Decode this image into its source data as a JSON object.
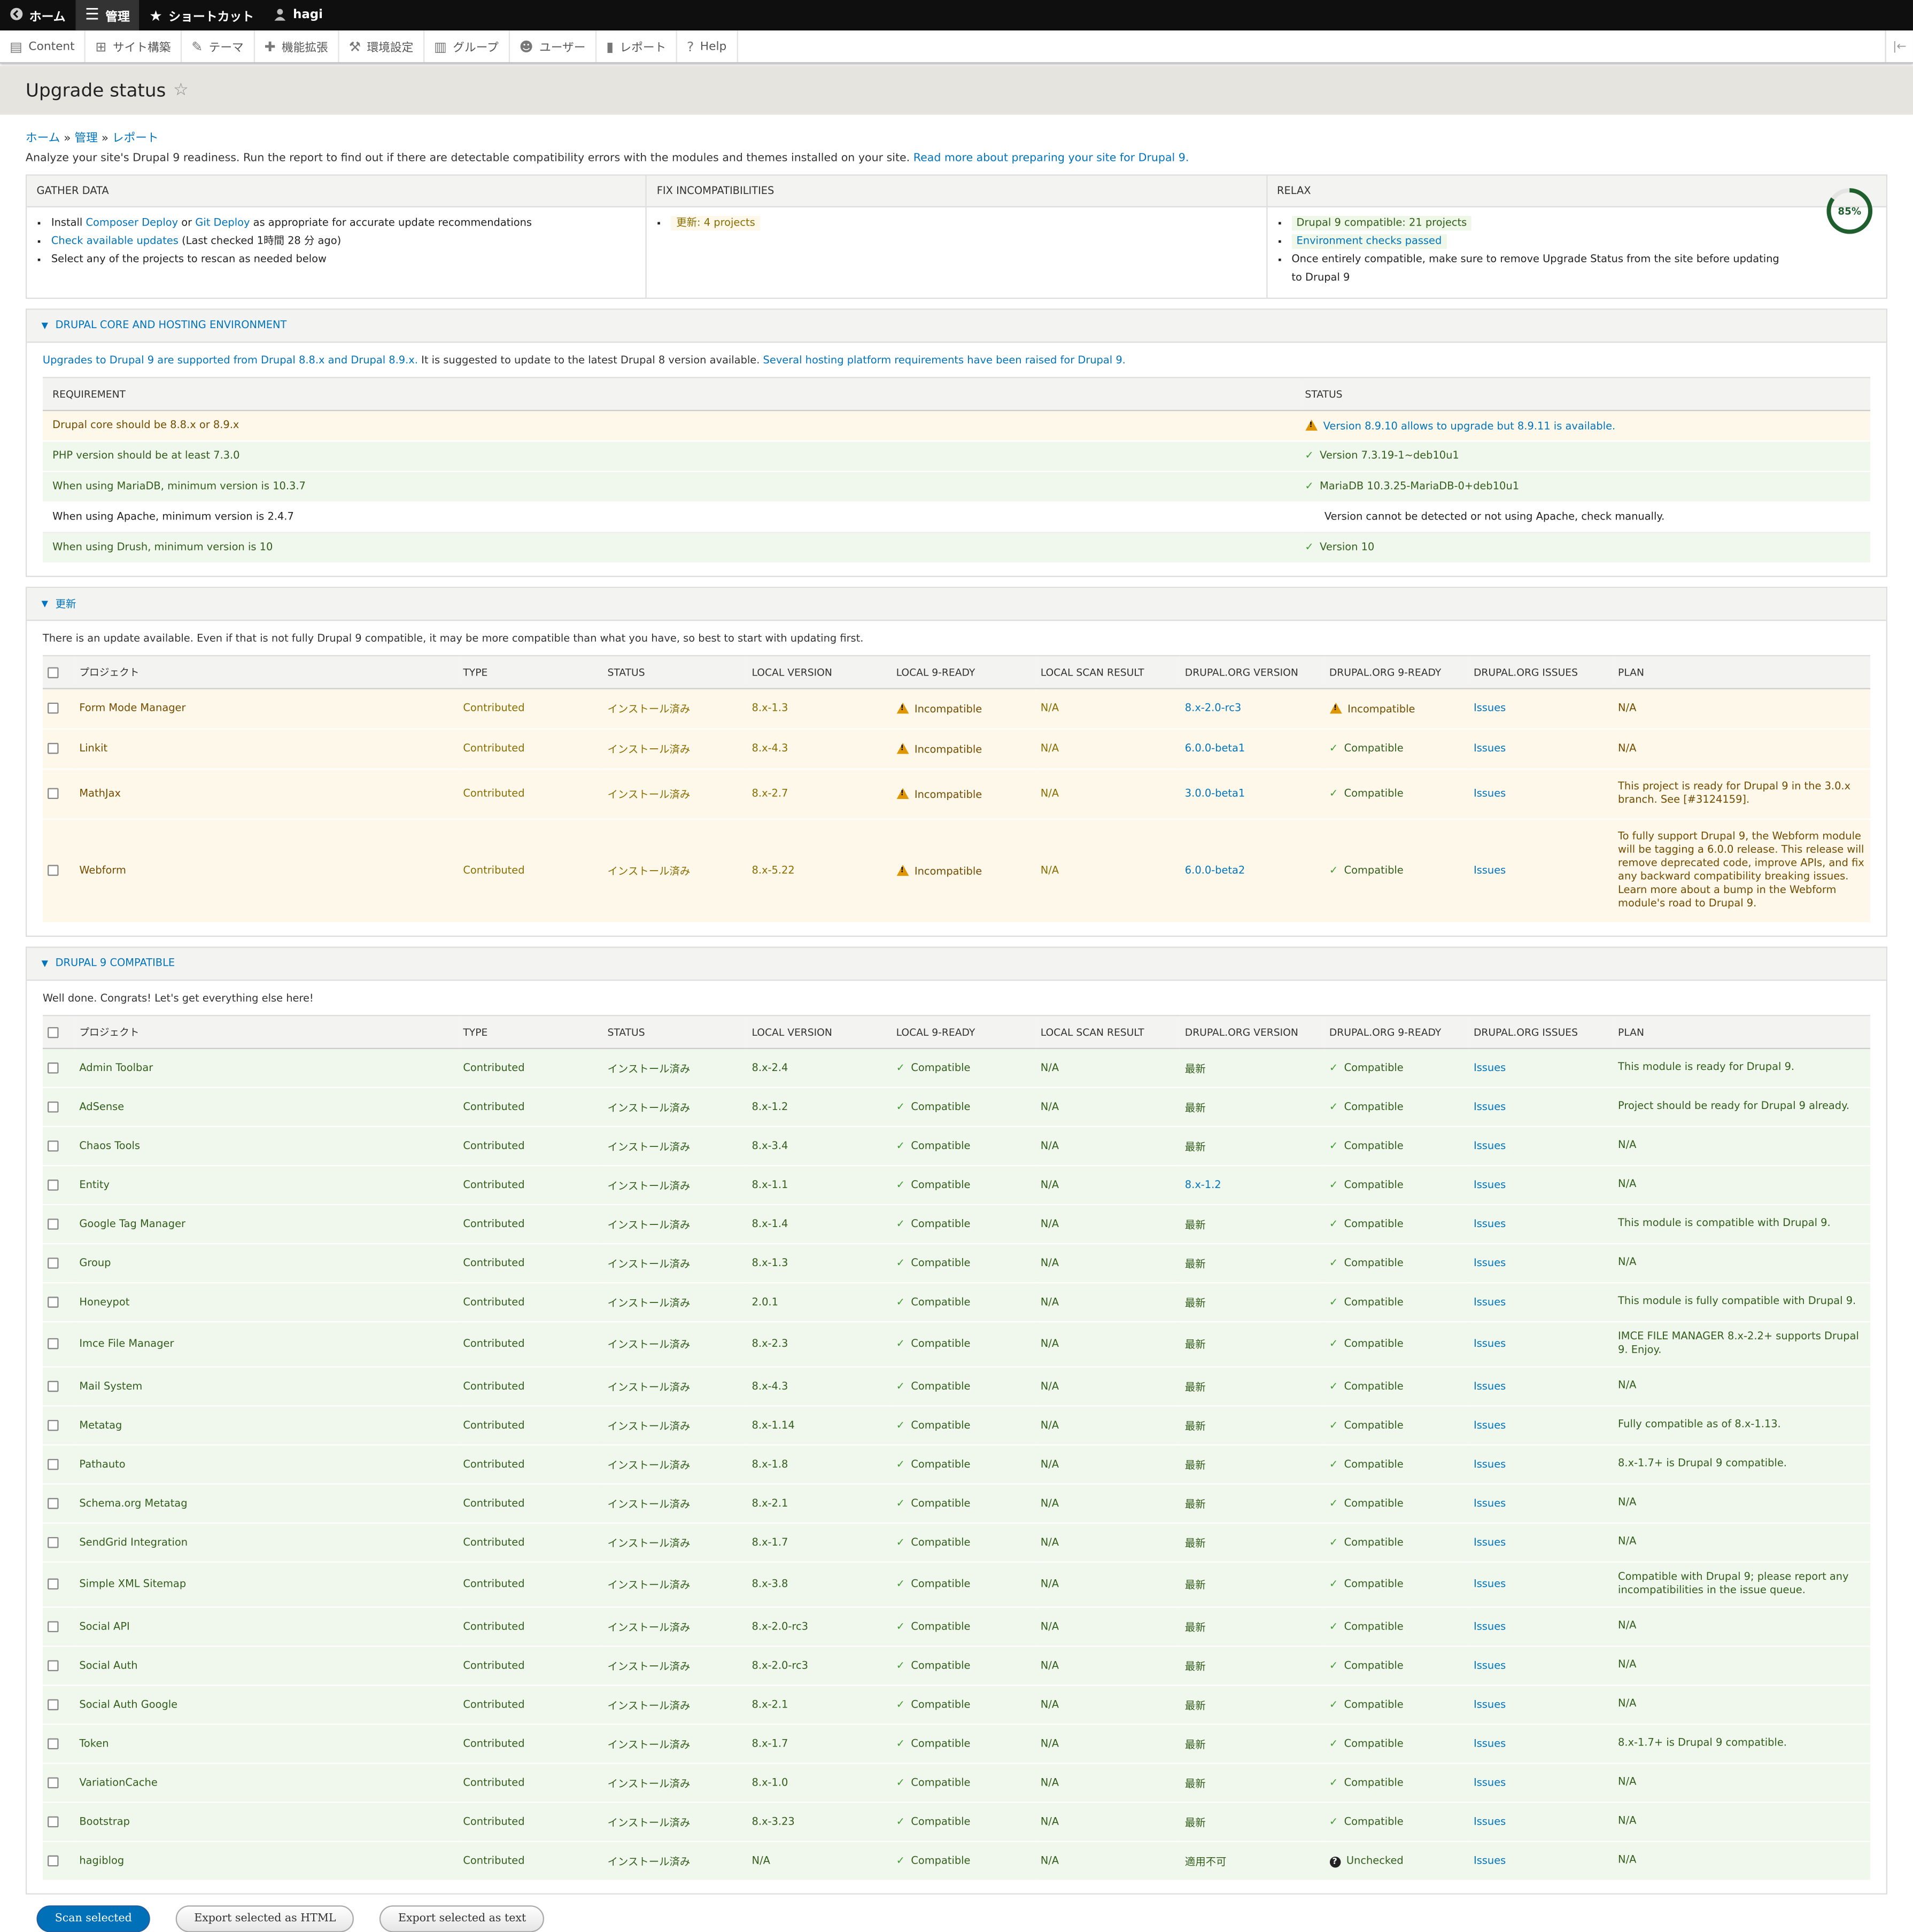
{
  "toolbar": {
    "items": [
      {
        "label": "ホーム",
        "icon": "drupal-back-icon"
      },
      {
        "label": "管理",
        "icon": "menu-icon"
      },
      {
        "label": "ショートカット",
        "icon": "star-icon"
      },
      {
        "label": "hagi",
        "icon": "user-icon"
      }
    ]
  },
  "tray": {
    "items": [
      {
        "label": "Content",
        "icon": "file-icon"
      },
      {
        "label": "サイト構築",
        "icon": "structure-icon"
      },
      {
        "label": "テーマ",
        "icon": "brush-icon"
      },
      {
        "label": "機能拡張",
        "icon": "puzzle-icon"
      },
      {
        "label": "環境設定",
        "icon": "wrench-icon"
      },
      {
        "label": "グループ",
        "icon": "group-icon"
      },
      {
        "label": "ユーザー",
        "icon": "people-icon"
      },
      {
        "label": "レポート",
        "icon": "bar-chart-icon"
      },
      {
        "label": "Help",
        "icon": "help-icon"
      }
    ]
  },
  "page": {
    "title": "Upgrade status",
    "breadcrumb": [
      "ホーム",
      "管理",
      "レポート"
    ],
    "intro_text": "Analyze your site's Drupal 9 readiness. Run the report to find out if there are detectable compatibility errors with the modules and themes installed on your site.",
    "intro_link": "Read more about preparing your site for Drupal 9."
  },
  "summary": {
    "gather": {
      "title": "GATHER DATA",
      "install_pre": "Install",
      "composer_deploy": "Composer Deploy",
      "or": "or",
      "git_deploy": "Git Deploy",
      "install_post": "as appropriate for accurate update recommendations",
      "check_updates": "Check available updates",
      "last_checked": "(Last checked 1時間 28 分 ago)",
      "select_text": "Select any of the projects to rescan as needed below"
    },
    "fix": {
      "title": "FIX INCOMPATIBILITIES",
      "item": "更新: 4 projects"
    },
    "relax": {
      "title": "RELAX",
      "compatible": "Drupal 9 compatible: 21 projects",
      "env": "Environment checks passed",
      "once": "Once entirely compatible, make sure to remove Upgrade Status from the site before updating to Drupal 9",
      "percent": 85,
      "percent_label": "85%"
    }
  },
  "core": {
    "title": "DRUPAL CORE AND HOSTING ENVIRONMENT",
    "desc_link1": "Upgrades to Drupal 9 are supported from Drupal 8.8.x and Drupal 8.9.x.",
    "desc_text": "It is suggested to update to the latest Drupal 8 version available.",
    "desc_link2": "Several hosting platform requirements have been raised for Drupal 9.",
    "col_requirement": "REQUIREMENT",
    "col_status": "STATUS",
    "rows": [
      {
        "req": "Drupal core should be 8.8.x or 8.9.x",
        "status": "Version 8.9.10 allows to upgrade but 8.9.11 is available.",
        "state": "warn",
        "status_link": true
      },
      {
        "req": "PHP version should be at least 7.3.0",
        "status": "Version 7.3.19-1~deb10u1",
        "state": "ok"
      },
      {
        "req": "When using MariaDB, minimum version is 10.3.7",
        "status": "MariaDB 10.3.25-MariaDB-0+deb10u1",
        "state": "ok"
      },
      {
        "req": "When using Apache, minimum version is 2.4.7",
        "status": "Version cannot be detected or not using Apache, check manually.",
        "state": "plain"
      },
      {
        "req": "When using Drush, minimum version is 10",
        "status": "Version 10",
        "state": "ok"
      }
    ]
  },
  "columns": [
    "プロジェクト",
    "TYPE",
    "STATUS",
    "LOCAL VERSION",
    "LOCAL 9-READY",
    "LOCAL SCAN RESULT",
    "DRUPAL.ORG VERSION",
    "DRUPAL.ORG 9-READY",
    "DRUPAL.ORG ISSUES",
    "PLAN"
  ],
  "updates": {
    "title": "更新",
    "desc": "There is an update available. Even if that is not fully Drupal 9 compatible, it may be more compatible than what you have, so best to start with updating first.",
    "rows": [
      {
        "name": "Form Mode Manager",
        "type": "Contributed",
        "status": "インストール済み",
        "local": "8.x-1.3",
        "local_ready": "Incompatible",
        "scan": "N/A",
        "org_version": "8.x-2.0-rc3",
        "org_ready": "Incompatible",
        "org_ready_state": "warn",
        "issues": "Issues",
        "plan": "N/A"
      },
      {
        "name": "Linkit",
        "type": "Contributed",
        "status": "インストール済み",
        "local": "8.x-4.3",
        "local_ready": "Incompatible",
        "scan": "N/A",
        "org_version": "6.0.0-beta1",
        "org_ready": "Compatible",
        "org_ready_state": "ok",
        "issues": "Issues",
        "plan": "N/A"
      },
      {
        "name": "MathJax",
        "type": "Contributed",
        "status": "インストール済み",
        "local": "8.x-2.7",
        "local_ready": "Incompatible",
        "scan": "N/A",
        "org_version": "3.0.0-beta1",
        "org_ready": "Compatible",
        "org_ready_state": "ok",
        "issues": "Issues",
        "plan": "This project is ready for Drupal 9 in the 3.0.x branch. See [#3124159]."
      },
      {
        "name": "Webform",
        "type": "Contributed",
        "status": "インストール済み",
        "local": "8.x-5.22",
        "local_ready": "Incompatible",
        "scan": "N/A",
        "org_version": "6.0.0-beta2",
        "org_ready": "Compatible",
        "org_ready_state": "ok",
        "issues": "Issues",
        "plan": "To fully support Drupal 9, the Webform module will be tagging a 6.0.0 release. This release will remove deprecated code, improve APIs, and fix any backward compatibility breaking issues. Learn more about a bump in the Webform module's road to Drupal 9."
      }
    ]
  },
  "compatible": {
    "title": "DRUPAL 9 COMPATIBLE",
    "desc": "Well done. Congrats! Let's get everything else here!",
    "rows": [
      {
        "name": "Admin Toolbar",
        "local": "8.x-2.4",
        "org_version": "最新",
        "org_ready": "Compatible",
        "plan": "This module is ready for Drupal 9."
      },
      {
        "name": "AdSense",
        "local": "8.x-1.2",
        "org_version": "最新",
        "org_ready": "Compatible",
        "plan": "Project should be ready for Drupal 9 already."
      },
      {
        "name": "Chaos Tools",
        "local": "8.x-3.4",
        "org_version": "最新",
        "org_ready": "Compatible",
        "plan": "N/A"
      },
      {
        "name": "Entity",
        "local": "8.x-1.1",
        "org_version": "8.x-1.2",
        "org_ready": "Compatible",
        "plan": "N/A",
        "org_link": true
      },
      {
        "name": "Google Tag Manager",
        "local": "8.x-1.4",
        "org_version": "最新",
        "org_ready": "Compatible",
        "plan": "This module is compatible with Drupal 9."
      },
      {
        "name": "Group",
        "local": "8.x-1.3",
        "org_version": "最新",
        "org_ready": "Compatible",
        "plan": "N/A"
      },
      {
        "name": "Honeypot",
        "local": "2.0.1",
        "org_version": "最新",
        "org_ready": "Compatible",
        "plan": "This module is fully compatible with Drupal 9."
      },
      {
        "name": "Imce File Manager",
        "local": "8.x-2.3",
        "org_version": "最新",
        "org_ready": "Compatible",
        "plan": "IMCE FILE MANAGER 8.x-2.2+ supports Drupal 9. Enjoy."
      },
      {
        "name": "Mail System",
        "local": "8.x-4.3",
        "org_version": "最新",
        "org_ready": "Compatible",
        "plan": "N/A"
      },
      {
        "name": "Metatag",
        "local": "8.x-1.14",
        "org_version": "最新",
        "org_ready": "Compatible",
        "plan": "Fully compatible as of 8.x-1.13."
      },
      {
        "name": "Pathauto",
        "local": "8.x-1.8",
        "org_version": "最新",
        "org_ready": "Compatible",
        "plan": "8.x-1.7+ is Drupal 9 compatible."
      },
      {
        "name": "Schema.org Metatag",
        "local": "8.x-2.1",
        "org_version": "最新",
        "org_ready": "Compatible",
        "plan": "N/A"
      },
      {
        "name": "SendGrid Integration",
        "local": "8.x-1.7",
        "org_version": "最新",
        "org_ready": "Compatible",
        "plan": "N/A"
      },
      {
        "name": "Simple XML Sitemap",
        "local": "8.x-3.8",
        "org_version": "最新",
        "org_ready": "Compatible",
        "plan": "Compatible with Drupal 9; please report any incompatibilities in the issue queue."
      },
      {
        "name": "Social API",
        "local": "8.x-2.0-rc3",
        "org_version": "最新",
        "org_ready": "Compatible",
        "plan": "N/A"
      },
      {
        "name": "Social Auth",
        "local": "8.x-2.0-rc3",
        "org_version": "最新",
        "org_ready": "Compatible",
        "plan": "N/A"
      },
      {
        "name": "Social Auth Google",
        "local": "8.x-2.1",
        "org_version": "最新",
        "org_ready": "Compatible",
        "plan": "N/A"
      },
      {
        "name": "Token",
        "local": "8.x-1.7",
        "org_version": "最新",
        "org_ready": "Compatible",
        "plan": "8.x-1.7+ is Drupal 9 compatible."
      },
      {
        "name": "VariationCache",
        "local": "8.x-1.0",
        "org_version": "最新",
        "org_ready": "Compatible",
        "plan": "N/A"
      },
      {
        "name": "Bootstrap",
        "local": "8.x-3.23",
        "org_version": "最新",
        "org_ready": "Compatible",
        "plan": "N/A"
      },
      {
        "name": "hagiblog",
        "local": "N/A",
        "org_version": "適用不可",
        "org_ready": "Unchecked",
        "plan": "N/A",
        "unchecked": true
      }
    ],
    "type": "Contributed",
    "status": "インストール済み",
    "local_ready": "Compatible",
    "scan": "N/A",
    "issues": "Issues"
  },
  "buttons": {
    "scan": "Scan selected",
    "export_html": "Export selected as HTML",
    "export_text": "Export selected as text"
  },
  "colors": {
    "accent": "#0074bd",
    "warn_bg": "#fdf8e9",
    "ok_bg": "#f0f7ec",
    "ok_green": "#3d9a2f"
  }
}
